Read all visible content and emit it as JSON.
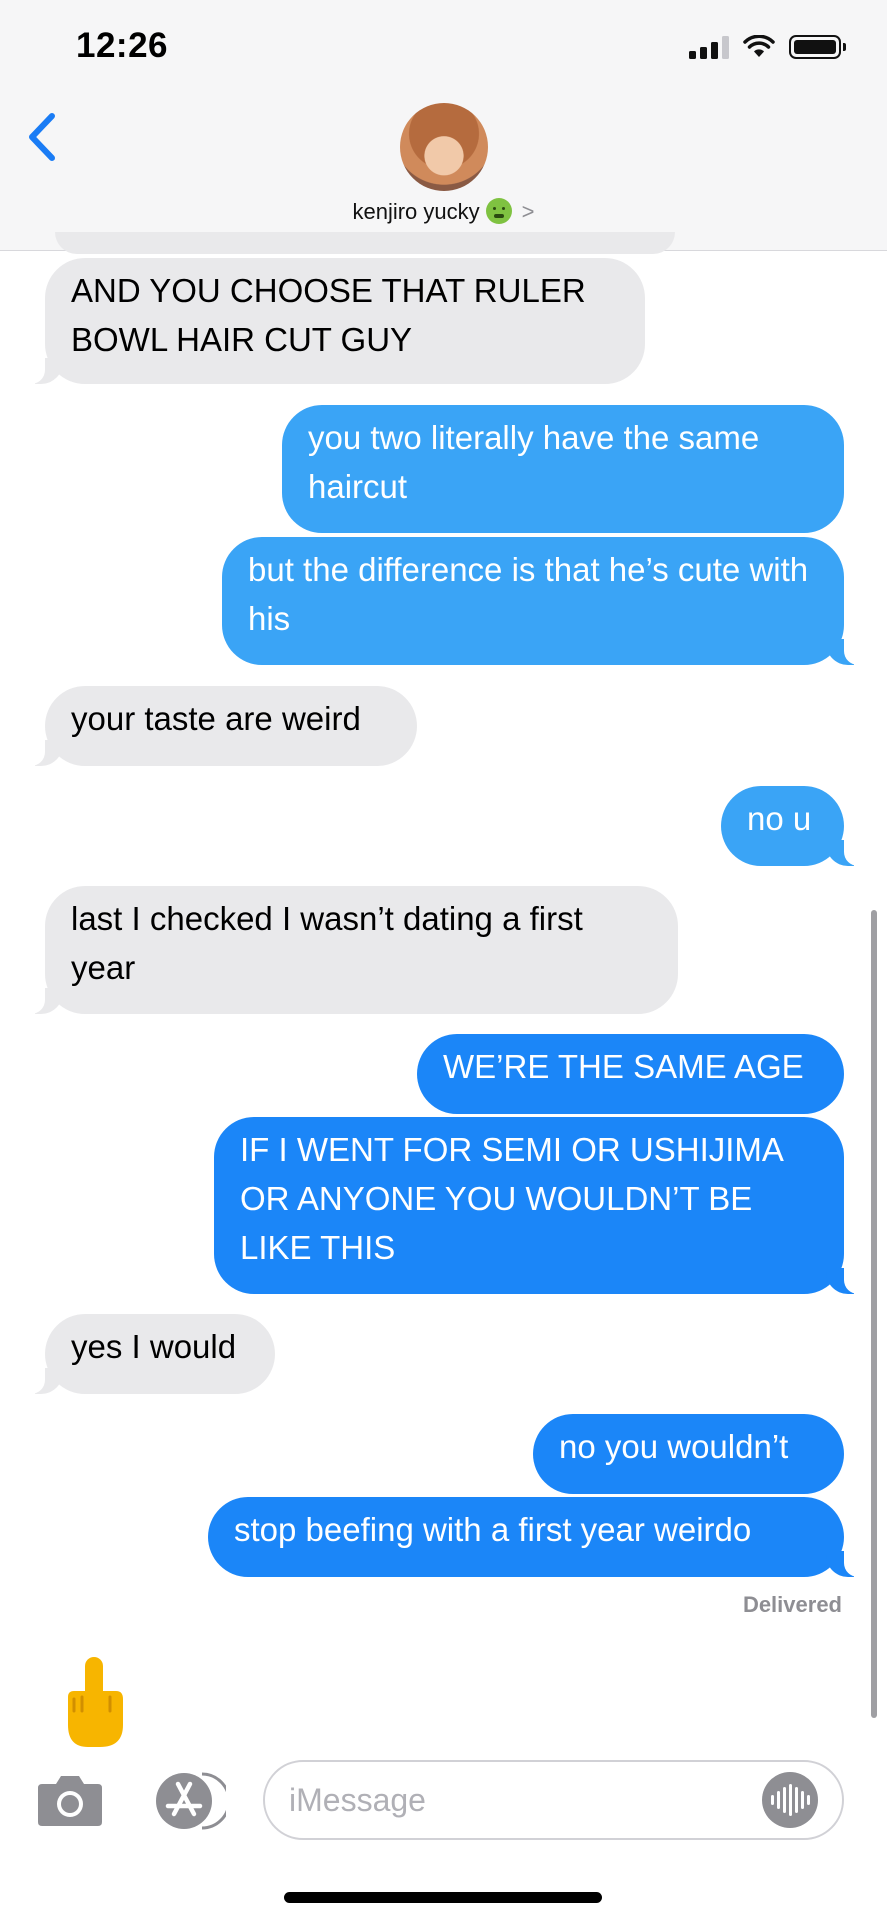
{
  "status_bar": {
    "time": "12:26"
  },
  "header": {
    "contact_name": "kenjiro yucky",
    "contact_emoji": "nauseated-face",
    "chevron": ">"
  },
  "messages": [
    {
      "side": "in",
      "text": "AND YOU CHOOSE THAT RULER BOWL HAIR CUT GUY"
    },
    {
      "side": "out",
      "text": "you two literally have the same haircut"
    },
    {
      "side": "out",
      "text": "but the difference is that he’s cute with his"
    },
    {
      "side": "in",
      "text": "your taste are weird"
    },
    {
      "side": "out",
      "text": "no u"
    },
    {
      "side": "in",
      "text": "last I checked I wasn’t dating a first year"
    },
    {
      "side": "out",
      "text": "WE’RE THE SAME AGE"
    },
    {
      "side": "out",
      "text": "IF I WENT FOR SEMI OR USHIJIMA OR ANYONE YOU WOULDN’T BE LIKE THIS"
    },
    {
      "side": "in",
      "text": "yes I would"
    },
    {
      "side": "out",
      "text": "no you wouldn’t"
    },
    {
      "side": "out",
      "text": "stop beefing with a first year weirdo"
    }
  ],
  "delivered_label": "Delivered",
  "draft_emoji": "middle-finger",
  "input": {
    "placeholder": "iMessage"
  },
  "colors": {
    "outgoing": "#1b86f8",
    "outgoing_light": "#3aa4f6",
    "incoming": "#e9e9eb",
    "accent": "#1a7cf5"
  }
}
